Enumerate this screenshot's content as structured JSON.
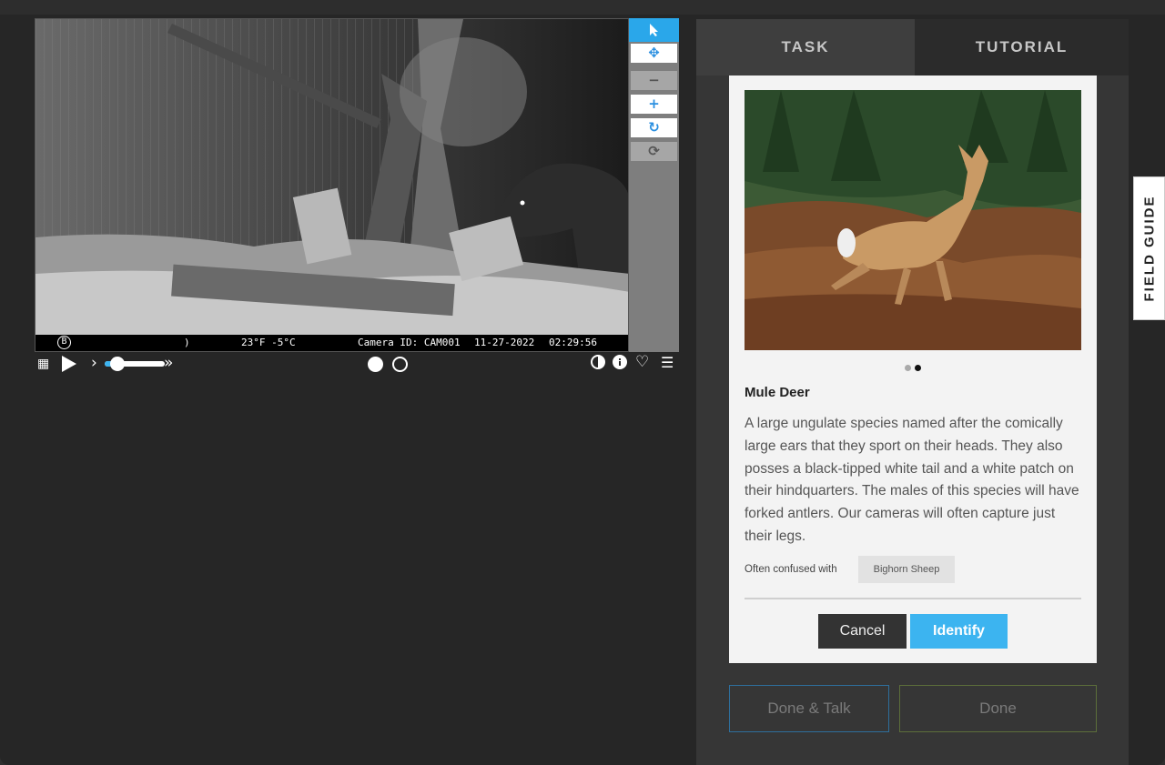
{
  "viewer": {
    "stamp": {
      "logo": "B",
      "moon": ")",
      "temperature": "23°F  -5°C",
      "camera": "Camera ID: CAM001",
      "date": "11-27-2022",
      "time": "02:29:56"
    },
    "toolbox": [
      "pointer-icon",
      "move-icon",
      "zoom-out-icon",
      "zoom-in-icon",
      "rotate-icon",
      "reset-icon"
    ],
    "controls": {
      "speed_slider_level": 0.15,
      "frame_indicator": [
        "filled",
        "empty"
      ]
    }
  },
  "tabs": {
    "task": "TASK",
    "tutorial": "TUTORIAL"
  },
  "card": {
    "species": "Mule Deer",
    "description": "A large ungulate species named after the comically large ears that they sport on their heads. They also posses a black-tipped white tail and a white patch on their hindquarters. The males of this species will have forked antlers. Our cameras will often capture just their legs.",
    "confused_label": "Often confused with",
    "confused_with": "Bighorn Sheep",
    "cancel": "Cancel",
    "identify": "Identify",
    "carousel_active": 2,
    "carousel_count": 2
  },
  "footer": {
    "done_talk": "Done & Talk",
    "done": "Done"
  },
  "field_guide": "FIELD GUIDE",
  "colors": {
    "accent": "#3cb4f0",
    "dark": "#262626",
    "card": "#f3f3f3"
  }
}
